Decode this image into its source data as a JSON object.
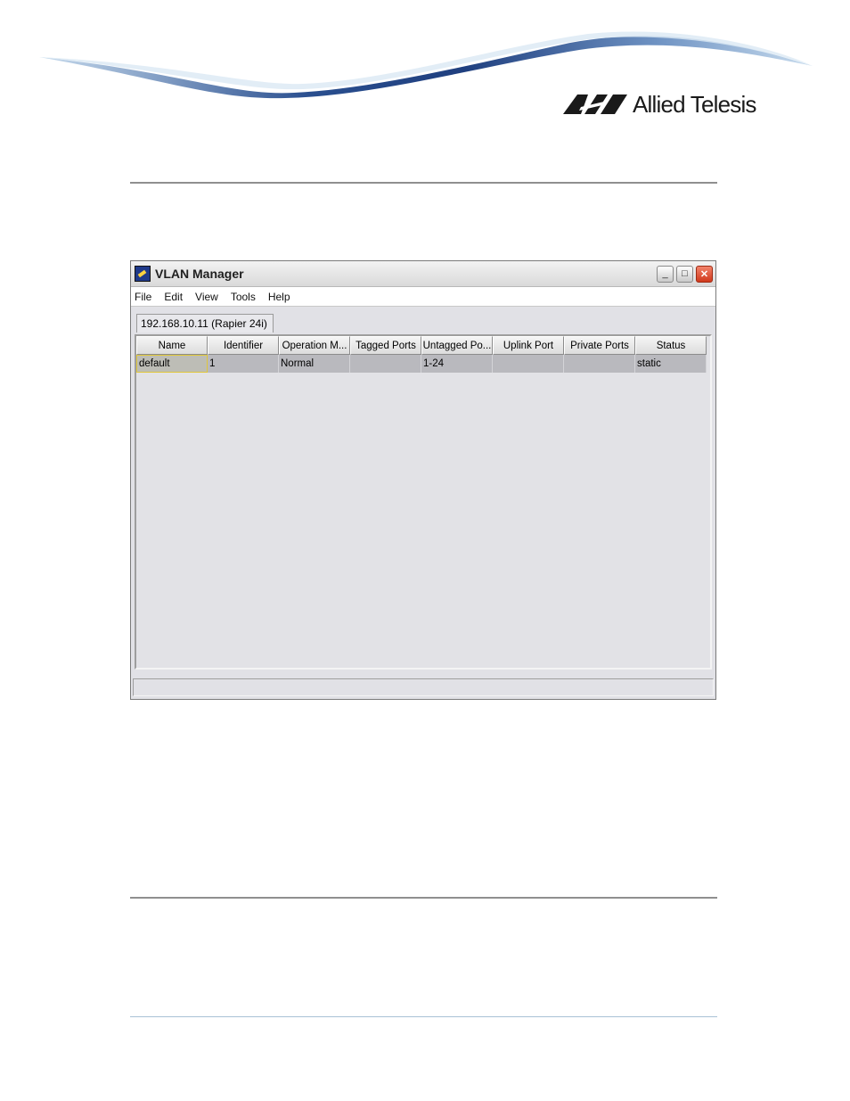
{
  "header": {
    "logo_text": "Allied Telesis",
    "link_text": ""
  },
  "window": {
    "title": "VLAN Manager",
    "controls": {
      "minimize": "_",
      "maximize": "□",
      "close": "✕"
    },
    "menu": [
      "File",
      "Edit",
      "View",
      "Tools",
      "Help"
    ],
    "tab_label": "192.168.10.11 (Rapier 24i)",
    "columns": [
      "Name",
      "Identifier",
      "Operation M...",
      "Tagged Ports",
      "Untagged Po...",
      "Uplink Port",
      "Private Ports",
      "Status"
    ],
    "rows": [
      [
        "default",
        "1",
        "Normal",
        "",
        "1-24",
        "",
        "",
        "static"
      ]
    ],
    "status_text": ""
  },
  "colors": {
    "accent_blue": "#203a8a",
    "swoosh_dark": "#1f3f7f",
    "swoosh_light": "#b8d2ea",
    "focus_border": "#e0c73a"
  }
}
